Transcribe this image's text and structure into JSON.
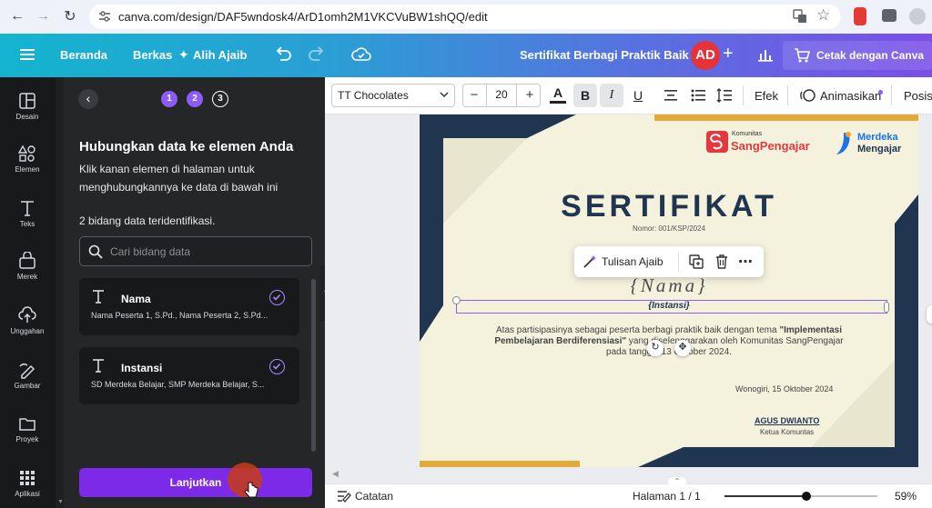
{
  "browser": {
    "url": "canva.com/design/DAF5wndosk4/ArD1omh2M1VKCVuBW1shQQ/edit"
  },
  "topbar": {
    "home": "Beranda",
    "file": "Berkas",
    "magic": "Alih Ajaib",
    "doc_title": "Sertifikat Berbagi Praktik Baik",
    "avatar": "AD",
    "print": "Cetak dengan Canva"
  },
  "rail": [
    {
      "label": "Desain",
      "icon": "layout-icon"
    },
    {
      "label": "Elemen",
      "icon": "shapes-icon"
    },
    {
      "label": "Teks",
      "icon": "text-icon"
    },
    {
      "label": "Merek",
      "icon": "brand-icon"
    },
    {
      "label": "Unggahan",
      "icon": "upload-icon"
    },
    {
      "label": "Gambar",
      "icon": "draw-icon"
    },
    {
      "label": "Proyek",
      "icon": "folder-icon"
    },
    {
      "label": "Aplikasi",
      "icon": "apps-icon"
    }
  ],
  "panel": {
    "steps": [
      "1",
      "2",
      "3"
    ],
    "title": "Hubungkan data ke elemen Anda",
    "desc_line1": "Klik kanan elemen di halaman untuk",
    "desc_line2": "menghubungkannya ke data di bawah ini",
    "count": "2 bidang data teridentifikasi.",
    "search_placeholder": "Cari bidang data",
    "fields": [
      {
        "name": "Nama",
        "values": "Nama Peserta 1, S.Pd., Nama Peserta 2, S.Pd..."
      },
      {
        "name": "Instansi",
        "values": "SD Merdeka Belajar, SMP Merdeka Belajar, S..."
      }
    ],
    "continue": "Lanjutkan"
  },
  "toolbar": {
    "font": "TT Chocolates",
    "size": "20",
    "bold": "B",
    "italic": "I",
    "underline": "U",
    "effects": "Efek",
    "animate": "Animasikan",
    "position": "Posisi"
  },
  "floating": {
    "magic_write": "Tulisan Ajaib"
  },
  "certificate": {
    "logo1_small": "Komunitas",
    "logo1_big": "SangPengajar",
    "logo2_line1": "Merdeka",
    "logo2_line2": "Mengajar",
    "title": "SERTIFIKAT",
    "number": "Nomor: 001/KSP/2024",
    "name": "{Nama}",
    "institution": "{Instansi}",
    "body_1": "Atas partisipasinya sebagai peserta berbagi praktik baik dengan tema ",
    "body_theme_1": "\"Implementasi",
    "body_theme_2": "Pembelajaran Berdiferensiasi\"",
    "body_2": " yang diselenggarakan oleh Komunitas SangPengajar",
    "body_3": "pada tanggal 13 Oktober 2024.",
    "place_date": "Wonogiri, 15 Oktober 2024",
    "signer": "AGUS DWIANTO",
    "signer_role": "Ketua Komuntas"
  },
  "bottom": {
    "notes": "Catatan",
    "page": "Halaman 1 / 1",
    "zoom": "59%",
    "zoom_level": 0.59
  },
  "colors": {
    "accent": "#7d2ae8",
    "navy": "#1f3550",
    "gold": "#e5a93a",
    "cert_bg": "#f4f1dd"
  }
}
